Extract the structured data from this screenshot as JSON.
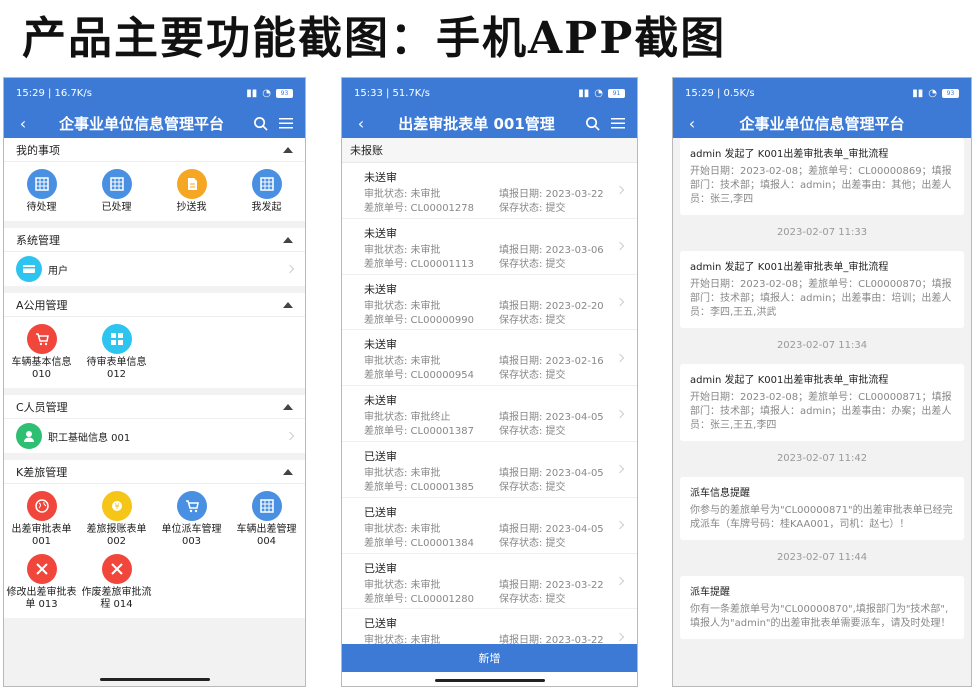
{
  "page_title": "产品主要功能截图：手机APP截图",
  "phone1": {
    "status_time": "15:29 | 16.7K/s",
    "battery": "93",
    "nav_title": "企事业单位信息管理平台",
    "sections": [
      {
        "title": "我的事项",
        "items": [
          {
            "label": "待处理",
            "color": "#4a90e2",
            "icon": "table-icon"
          },
          {
            "label": "已处理",
            "color": "#4a90e2",
            "icon": "table-icon"
          },
          {
            "label": "抄送我",
            "color": "#f5a623",
            "icon": "document-icon"
          },
          {
            "label": "我发起",
            "color": "#4a90e2",
            "icon": "table-icon"
          }
        ]
      },
      {
        "title": "系统管理",
        "row": {
          "label": "用户",
          "color": "#2ec4f0",
          "icon": "card-icon"
        }
      },
      {
        "title": "A公用管理",
        "items": [
          {
            "label": "车辆基本信息 010",
            "color": "#f0463c",
            "icon": "cart-icon"
          },
          {
            "label": "待审表单信息 012",
            "color": "#2ec4f0",
            "icon": "grid-icon"
          }
        ]
      },
      {
        "title": "C人员管理",
        "row": {
          "label": "职工基础信息 001",
          "color": "#2ebf72",
          "icon": "person-icon"
        }
      },
      {
        "title": "K差旅管理",
        "items": [
          {
            "label": "出差审批表单 001",
            "color": "#f0463c",
            "icon": "globe-icon"
          },
          {
            "label": "差旅报账表单 002",
            "color": "#f5c518",
            "icon": "coin-icon"
          },
          {
            "label": "单位派车管理 003",
            "color": "#4a90e2",
            "icon": "cart-icon"
          },
          {
            "label": "车辆出差管理 004",
            "color": "#4a90e2",
            "icon": "table-icon"
          },
          {
            "label": "修改出差审批表单 013",
            "color": "#f0463c",
            "icon": "tools-icon"
          },
          {
            "label": "作废差旅审批流程 014",
            "color": "#f0463c",
            "icon": "tools-icon"
          }
        ]
      }
    ]
  },
  "phone2": {
    "status_time": "15:33 | 51.7K/s",
    "battery": "91",
    "nav_title": "出差审批表单 001管理",
    "subhead": "未报账",
    "records": [
      {
        "status": "未送审",
        "approval": "审批状态: 未审批",
        "date": "填报日期: 2023-03-22",
        "no": "差旅单号: CL00001278",
        "save": "保存状态: 提交"
      },
      {
        "status": "未送审",
        "approval": "审批状态: 未审批",
        "date": "填报日期: 2023-03-06",
        "no": "差旅单号: CL00001113",
        "save": "保存状态: 提交"
      },
      {
        "status": "未送审",
        "approval": "审批状态: 未审批",
        "date": "填报日期: 2023-02-20",
        "no": "差旅单号: CL00000990",
        "save": "保存状态: 提交"
      },
      {
        "status": "未送审",
        "approval": "审批状态: 未审批",
        "date": "填报日期: 2023-02-16",
        "no": "差旅单号: CL00000954",
        "save": "保存状态: 提交"
      },
      {
        "status": "未送审",
        "approval": "审批状态: 审批终止",
        "date": "填报日期: 2023-04-05",
        "no": "差旅单号: CL00001387",
        "save": "保存状态: 提交"
      },
      {
        "status": "已送审",
        "approval": "审批状态: 未审批",
        "date": "填报日期: 2023-04-05",
        "no": "差旅单号: CL00001385",
        "save": "保存状态: 提交"
      },
      {
        "status": "已送审",
        "approval": "审批状态: 未审批",
        "date": "填报日期: 2023-04-05",
        "no": "差旅单号: CL00001384",
        "save": "保存状态: 提交"
      },
      {
        "status": "已送审",
        "approval": "审批状态: 未审批",
        "date": "填报日期: 2023-03-22",
        "no": "差旅单号: CL00001280",
        "save": "保存状态: 提交"
      },
      {
        "status": "已送审",
        "approval": "审批状态: 未审批",
        "date": "填报日期: 2023-03-22",
        "no": "",
        "save": ""
      }
    ],
    "add_button": "新增"
  },
  "phone3": {
    "status_time": "15:29 | 0.5K/s",
    "battery": "93",
    "nav_title": "企事业单位信息管理平台",
    "feed": [
      {
        "timestamp": "",
        "title": "admin 发起了 K001出差审批表单_审批流程",
        "body": "开始日期：2023-02-08；差旅单号：CL00000869；填报部门：技术部；填报人：admin；出差事由：其他；出差人员：张三,李四"
      },
      {
        "timestamp": "2023-02-07 11:33",
        "title": "admin 发起了 K001出差审批表单_审批流程",
        "body": "开始日期：2023-02-08；差旅单号：CL00000870；填报部门：技术部；填报人：admin；出差事由：培训；出差人员：李四,王五,洪武"
      },
      {
        "timestamp": "2023-02-07 11:34",
        "title": "admin 发起了 K001出差审批表单_审批流程",
        "body": "开始日期：2023-02-08；差旅单号：CL00000871；填报部门：技术部；填报人：admin；出差事由：办案；出差人员：张三,王五,李四"
      },
      {
        "timestamp": "2023-02-07 11:42",
        "title": "派车信息提醒",
        "body": "你参与的差旅单号为\"CL00000871\"的出差审批表单已经完成派车（车牌号码：桂KAA001，司机：赵七）！"
      },
      {
        "timestamp": "2023-02-07 11:44",
        "title": "派车提醒",
        "body": "你有一条差旅单号为\"CL00000870\",填报部门为\"技术部\",填报人为\"admin\"的出差审批表单需要派车，请及时处理！"
      }
    ]
  }
}
